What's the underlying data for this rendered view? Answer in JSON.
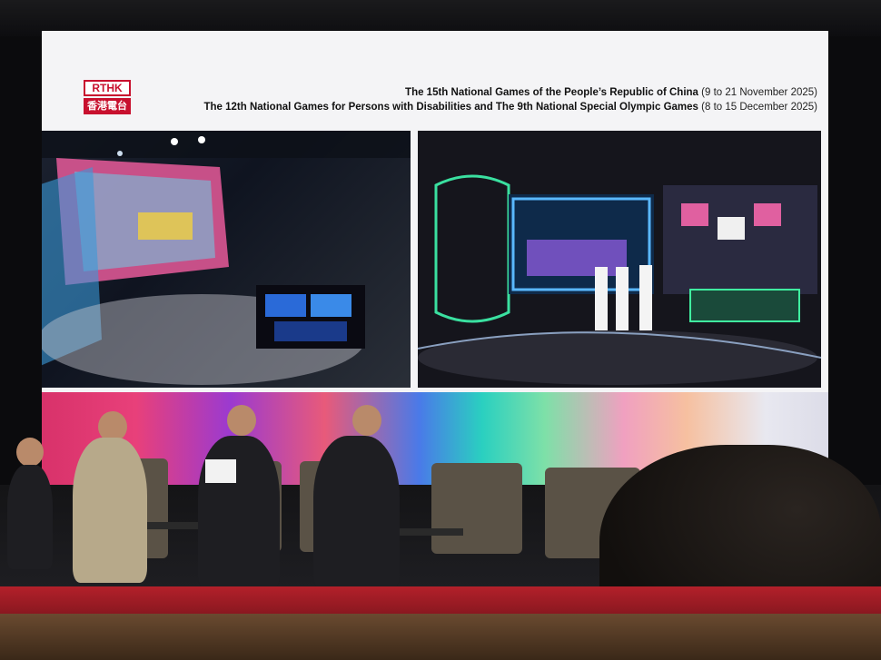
{
  "slide": {
    "logo": {
      "top": "RTHK",
      "bottom": "香港電台"
    },
    "header_line1_bold": "The 15th National Games of the People’s Republic of China",
    "header_line1_rest": " (9 to 21 November 2025)",
    "header_line2_bold": "The 12th National Games for Persons with Disabilities and The 9th National Special Olympic Games",
    "header_line2_rest": " (8 to 15 December 2025)"
  },
  "colors": {
    "brand_red": "#c8102e",
    "carpet_red": "#b3202a"
  }
}
